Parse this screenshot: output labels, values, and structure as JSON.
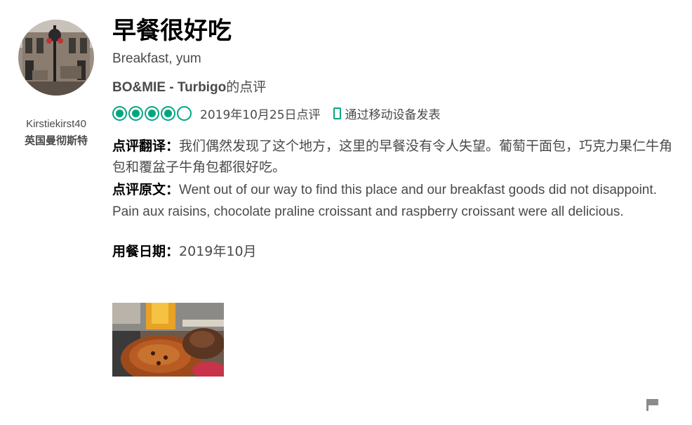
{
  "user": {
    "avatar_icon": "user-avatar-photo",
    "username": "Kirstiekirst40",
    "location": "英国曼彻斯特"
  },
  "review": {
    "title": "早餐很好吃",
    "subtitle": "Breakfast, yum",
    "place_name": "BO&MIE - Turbigo",
    "place_suffix": "的点评",
    "rating": 4,
    "rating_max": 5,
    "rating_color": "#00a680",
    "date": "2019年10月25日点评",
    "mobile_icon": "phone-icon",
    "mobile_label": "通过移动设备发表",
    "translated_label": "点评翻译：",
    "translated_text": "我们偶然发现了这个地方，这里的早餐没有令人失望。葡萄干面包，巧克力果仁牛角包和覆盆子牛角包都很好吃。",
    "original_label": "点评原文：",
    "original_text": "Went out of our way to find this place and our breakfast goods did not disappoint. Pain aux raisins, chocolate praline croissant and raspberry croissant were all delicious.",
    "visit_label": "用餐日期：",
    "visit_date": "2019年10月",
    "photo_icon": "pastry-photo"
  },
  "actions": {
    "flag_icon": "flag-icon"
  }
}
